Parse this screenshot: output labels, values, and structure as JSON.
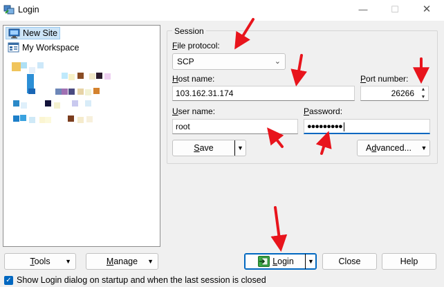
{
  "window": {
    "title": "Login",
    "controls": {
      "minimize": "—",
      "maximize": "☐",
      "close": "✕"
    }
  },
  "tree": {
    "items": [
      {
        "label": "New Site",
        "icon": "computer-icon"
      },
      {
        "label": "My Workspace",
        "icon": "workspace-icon"
      }
    ]
  },
  "session": {
    "legend": "Session",
    "file_protocol": {
      "label_mnemonic": "F",
      "label_rest": "ile protocol:",
      "value": "SCP"
    },
    "host_name": {
      "label_mnemonic": "H",
      "label_rest": "ost name:",
      "value": "103.162.31.174"
    },
    "port_number": {
      "label_mnemonic": "P",
      "label_rest": "ort number:",
      "value": "26266"
    },
    "user_name": {
      "label_mnemonic": "U",
      "label_rest": "ser name:",
      "value": "root"
    },
    "password": {
      "label_mnemonic": "P",
      "label_rest": "assword:",
      "value": "●●●●●●●●●"
    },
    "save_button": {
      "mnemonic": "S",
      "rest": "ave"
    },
    "advanced_button": {
      "pre": "A",
      "mnemonic": "d",
      "rest": "vanced..."
    }
  },
  "bottom": {
    "tools": {
      "mnemonic": "T",
      "rest": "ools"
    },
    "manage": {
      "mnemonic": "M",
      "rest": "anage"
    },
    "login": {
      "mnemonic": "L",
      "rest": "ogin"
    },
    "close": "Close",
    "help": "Help",
    "show_login_checkbox": {
      "checked": true,
      "label": "Show Login dialog on startup and when the last session is closed"
    }
  },
  "colors": {
    "accent": "#0067c0",
    "selection": "#cce4f7",
    "arrow": "#e8141c"
  },
  "annotations": {
    "arrows": 7,
    "color_name": "red"
  }
}
